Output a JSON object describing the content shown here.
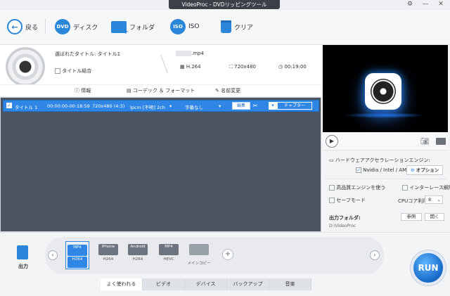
{
  "window": {
    "title": "VideoProc - DVDリッピングツール"
  },
  "toolbar": {
    "back": "戻る",
    "disc": "ディスク",
    "disc_badge": "DVD",
    "folder": "フォルダ",
    "iso": "ISO",
    "iso_badge": "ISO",
    "clear": "クリア"
  },
  "source": {
    "selected_title": "選ばれたタイトル: タイトル1",
    "merge_titles": "タイトル結合",
    "output_file": ".mp4",
    "codec": "H.264",
    "resolution": "720x480",
    "duration": "00:19:00"
  },
  "tabs": {
    "info": "情報",
    "codec_format": "コーデック ＆ フォーマット",
    "rename": "名前変更"
  },
  "title_row": {
    "name": "タイトル 1",
    "time_range": "00:00:00-00:18:59",
    "resolution": "720x480 (4:3)",
    "audio": "lpcm [不明] 2ch",
    "subtitle": "字幕なし",
    "edit": "編集",
    "chapter": "チャプター"
  },
  "options": {
    "hw_title": "ハードウェアアクセラレーションエンジン:",
    "hw_gpu": "Nvidia / Intel / AMD",
    "option_btn": "オプション",
    "hq_engine": "高品質エンジンを使う",
    "deinterlace": "インターレース解除",
    "safe_mode": "セーフモード",
    "cpu_label": "CPUコア利用",
    "cpu_value": "8",
    "output_folder_label": "出力フォルダ:",
    "output_path": "D:\\VideoProc",
    "browse": "参照",
    "open": "開く"
  },
  "profiles": {
    "output_label": "出力",
    "items": [
      {
        "top": "MP4",
        "bottom": "H264"
      },
      {
        "top": "iPhone",
        "bottom": "H264"
      },
      {
        "top": "Android",
        "bottom": "H264"
      },
      {
        "top": "MP4",
        "bottom": "HEVC"
      },
      {
        "top": "",
        "bottom": "メインコピー"
      }
    ]
  },
  "bottom_tabs": [
    "よく使われる",
    "ビデオ",
    "デバイス",
    "バックアップ",
    "音楽"
  ],
  "run_label": "RUN",
  "colors": {
    "accent": "#2f86e4",
    "list_bg": "#4b5460",
    "run": "#1768c8"
  }
}
